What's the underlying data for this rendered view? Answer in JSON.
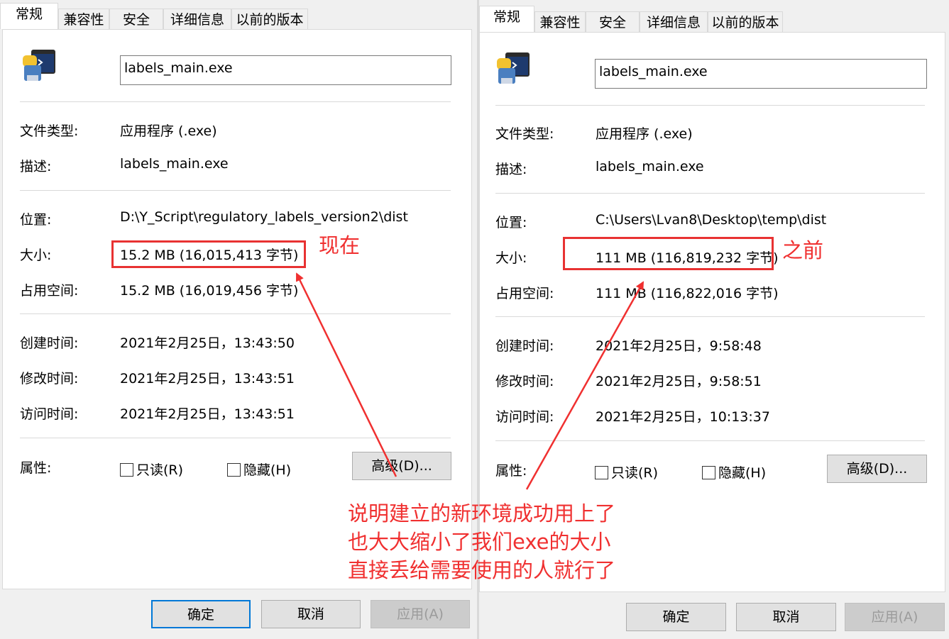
{
  "left": {
    "tabs": [
      "常规",
      "兼容性",
      "安全",
      "详细信息",
      "以前的版本"
    ],
    "filename": "labels_main.exe",
    "rows": [
      {
        "label": "文件类型:",
        "value": "应用程序 (.exe)"
      },
      {
        "label": "描述:",
        "value": "labels_main.exe"
      },
      {
        "label": "位置:",
        "value": "D:\\Y_Script\\regulatory_labels_version2\\dist"
      },
      {
        "label": "大小:",
        "value": "15.2 MB (16,015,413 字节)"
      },
      {
        "label": "占用空间:",
        "value": "15.2 MB (16,019,456 字节)"
      },
      {
        "label": "创建时间:",
        "value": "2021年2月25日，13:43:50"
      },
      {
        "label": "修改时间:",
        "value": "2021年2月25日，13:43:51"
      },
      {
        "label": "访问时间:",
        "value": "2021年2月25日，13:43:51"
      }
    ],
    "attributes_label": "属性:",
    "readonly_label": "只读(R)",
    "hidden_label": "隐藏(H)",
    "advanced_button": "高级(D)...",
    "ok_button": "确定",
    "cancel_button": "取消",
    "apply_button": "应用(A)",
    "annotation": "现在"
  },
  "right": {
    "tabs": [
      "常规",
      "兼容性",
      "安全",
      "详细信息",
      "以前的版本"
    ],
    "filename": "labels_main.exe",
    "rows": [
      {
        "label": "文件类型:",
        "value": "应用程序 (.exe)"
      },
      {
        "label": "描述:",
        "value": "labels_main.exe"
      },
      {
        "label": "位置:",
        "value": "C:\\Users\\Lvan8\\Desktop\\temp\\dist"
      },
      {
        "label": "大小:",
        "value": "111 MB (116,819,232 字节)"
      },
      {
        "label": "占用空间:",
        "value": "111 MB (116,822,016 字节)"
      },
      {
        "label": "创建时间:",
        "value": "2021年2月25日，9:58:48"
      },
      {
        "label": "修改时间:",
        "value": "2021年2月25日，9:58:51"
      },
      {
        "label": "访问时间:",
        "value": "2021年2月25日，10:13:37"
      }
    ],
    "attributes_label": "属性:",
    "readonly_label": "只读(R)",
    "hidden_label": "隐藏(H)",
    "advanced_button": "高级(D)...",
    "ok_button": "确定",
    "cancel_button": "取消",
    "apply_button": "应用(A)",
    "annotation": "之前"
  },
  "note": {
    "line1": "说明建立的新环境成功用上了",
    "line2": "也大大缩小了我们exe的大小",
    "line3": "直接丢给需要使用的人就行了"
  },
  "colors": {
    "annotation_red": "#f03030",
    "focus_blue": "#0078d7"
  }
}
